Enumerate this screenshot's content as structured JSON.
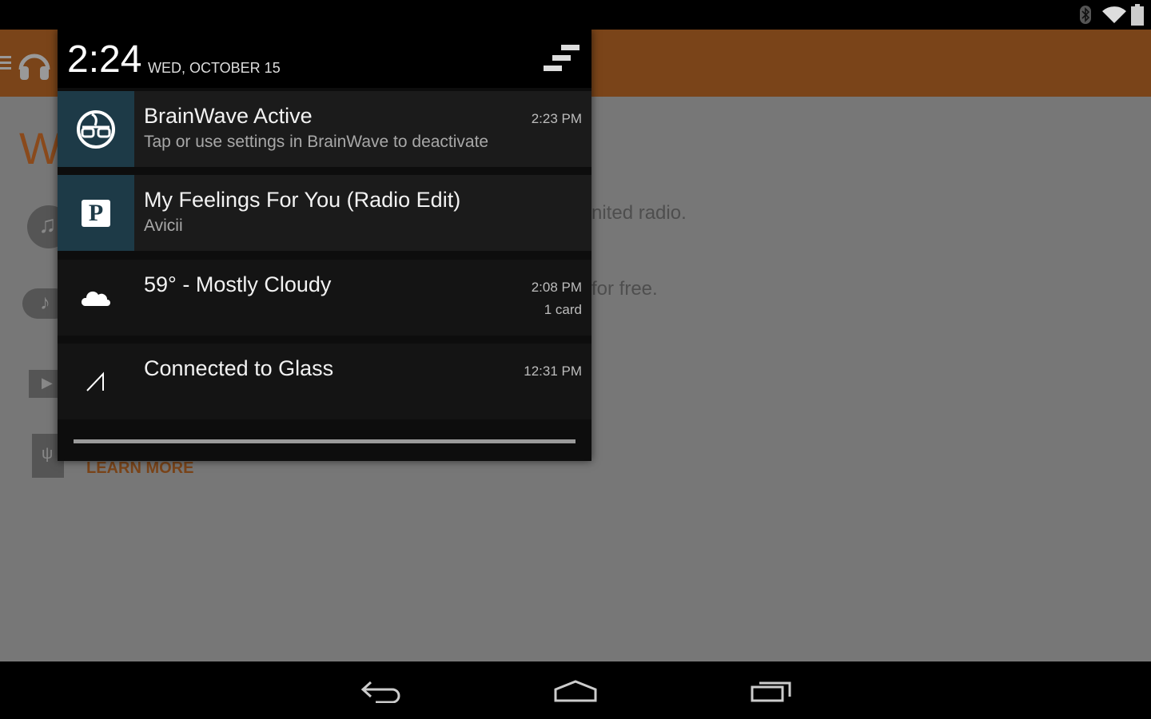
{
  "status_bar": {
    "icons": [
      "bluetooth-icon",
      "wifi-icon",
      "battery-icon"
    ]
  },
  "background_app": {
    "title_initial": "W",
    "line1": "nited radio.",
    "line2": "for free.",
    "learn_more": "LEARN MORE",
    "accent": "#c0601c",
    "appbar_color": "#7a4419"
  },
  "panel": {
    "time": "2:24",
    "date": "WED, OCTOBER 15",
    "notifications": [
      {
        "icon": "brainwave-icon",
        "title": "BrainWave Active",
        "text": "Tap or use settings in BrainWave to deactivate",
        "time": "2:23 PM",
        "icon_bg": "#1d3a47"
      },
      {
        "icon": "pandora-icon",
        "title": "My Feelings For You (Radio Edit)",
        "text": "Avicii",
        "icon_bg": "#1d3a47"
      },
      {
        "icon": "cloud-icon",
        "title": "59° - Mostly Cloudy",
        "time": "2:08 PM",
        "extra": "1 card"
      },
      {
        "icon": "glass-icon",
        "title": "Connected to Glass",
        "time": "12:31 PM"
      }
    ]
  },
  "nav_bar": {
    "buttons": [
      "back",
      "home",
      "recents"
    ]
  }
}
